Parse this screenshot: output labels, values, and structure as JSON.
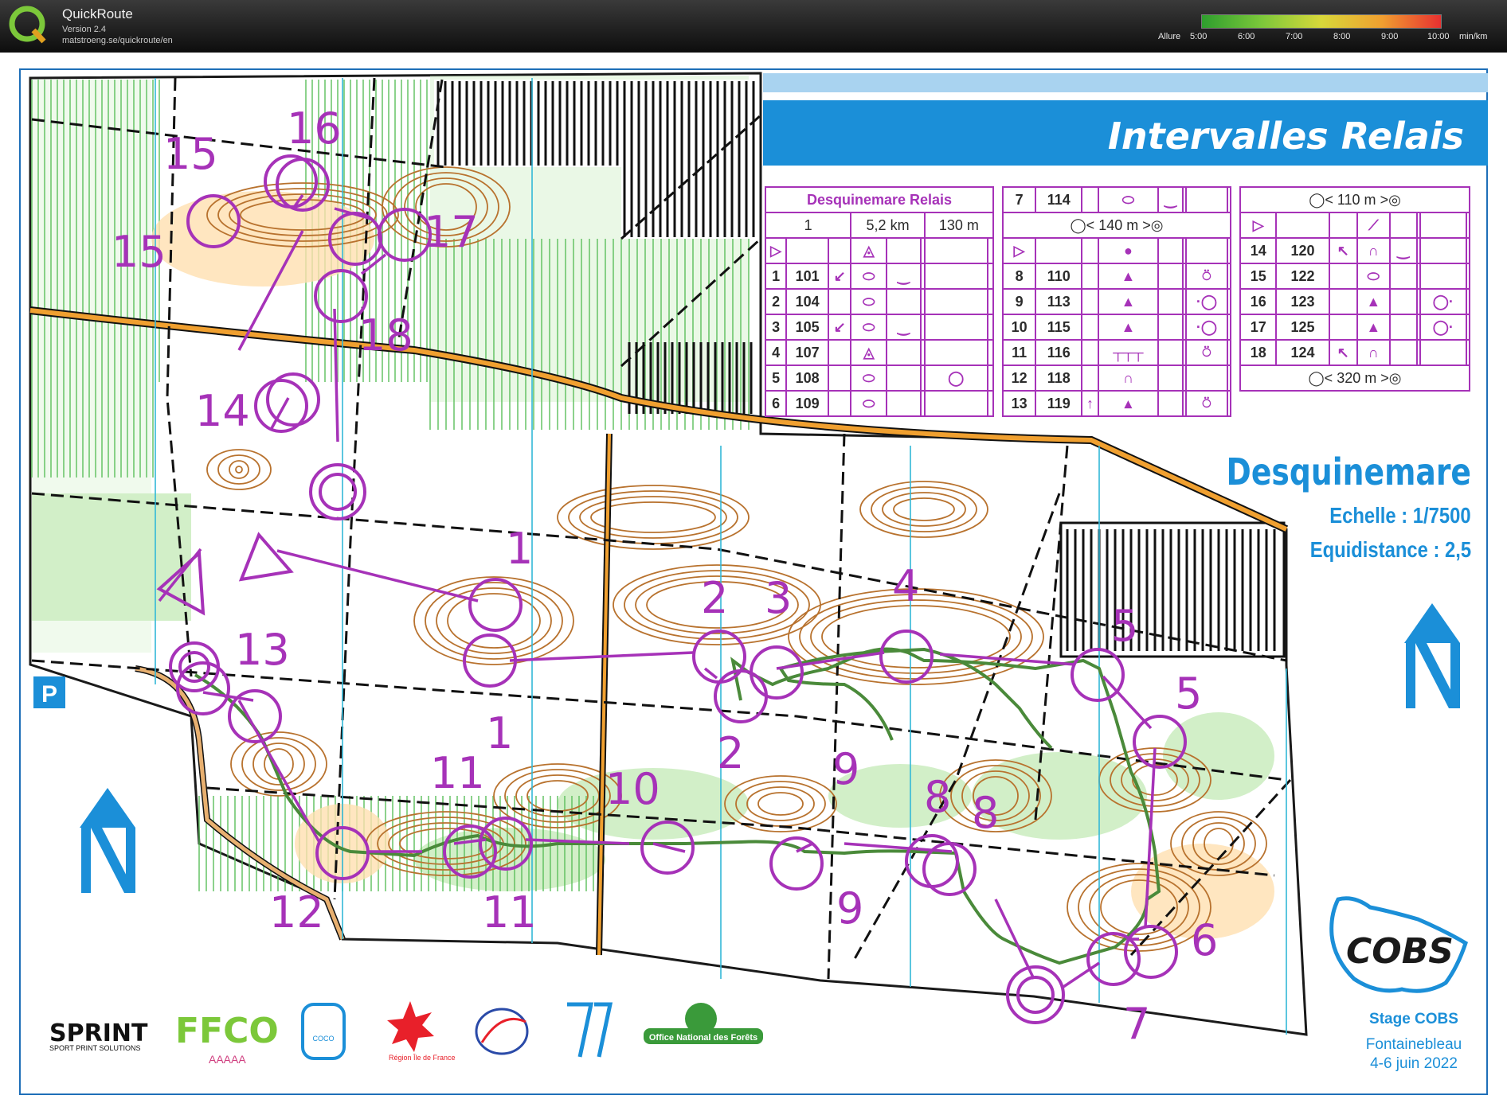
{
  "app": {
    "name": "QuickRoute",
    "version": "Version 2.4",
    "url": "matstroeng.se/quickroute/en"
  },
  "pace_legend": {
    "label": "Allure",
    "ticks": [
      "5:00",
      "6:00",
      "7:00",
      "8:00",
      "9:00",
      "10:00"
    ],
    "unit": "min/km"
  },
  "map": {
    "title": "Intervalles Relais",
    "area_name": "Desquinemare",
    "scale": "Echelle : 1/7500",
    "equidistance": "Equidistance : 2,5",
    "colors": {
      "course": "#a632b8",
      "brand_blue": "#1b8fd8",
      "route": "#4a8a3a"
    },
    "control_labels": [
      "1",
      "1",
      "2",
      "2",
      "3",
      "4",
      "5",
      "5",
      "6",
      "7",
      "8",
      "8",
      "9",
      "9",
      "10",
      "11",
      "11",
      "12",
      "13",
      "14",
      "15",
      "15",
      "16",
      "17",
      "18"
    ]
  },
  "description_sheets": [
    {
      "title": "Desquinemare Relais",
      "course": "1",
      "length": "5,2 km",
      "climb": "130 m",
      "rows": [
        {
          "n": "1",
          "code": "101"
        },
        {
          "n": "2",
          "code": "104"
        },
        {
          "n": "3",
          "code": "105"
        },
        {
          "n": "4",
          "code": "107"
        },
        {
          "n": "5",
          "code": "108"
        },
        {
          "n": "6",
          "code": "109"
        }
      ]
    },
    {
      "header_n": "7",
      "header_code": "114",
      "leg": "140 m",
      "rows": [
        {
          "n": "8",
          "code": "110"
        },
        {
          "n": "9",
          "code": "113"
        },
        {
          "n": "10",
          "code": "115"
        },
        {
          "n": "11",
          "code": "116"
        },
        {
          "n": "12",
          "code": "118"
        },
        {
          "n": "13",
          "code": "119"
        }
      ]
    },
    {
      "leg_top": "110 m",
      "leg_bottom": "320 m",
      "rows": [
        {
          "n": "14",
          "code": "120"
        },
        {
          "n": "15",
          "code": "122"
        },
        {
          "n": "16",
          "code": "123"
        },
        {
          "n": "17",
          "code": "125"
        },
        {
          "n": "18",
          "code": "124"
        }
      ]
    }
  ],
  "event": {
    "stage": "Stage COBS",
    "place": "Fontainebleau",
    "dates": "4-6 juin 2022"
  },
  "logos": {
    "sprint": "SPRINT",
    "sprint_sub": "SPORT PRINT SOLUTIONS",
    "ffco": "FFCO",
    "ffco_sub": "AAAAA",
    "coco": "COCO",
    "region": "Région Île de France",
    "onf": "Office National des Forêts",
    "cobs": "COBS",
    "parking": "P"
  }
}
